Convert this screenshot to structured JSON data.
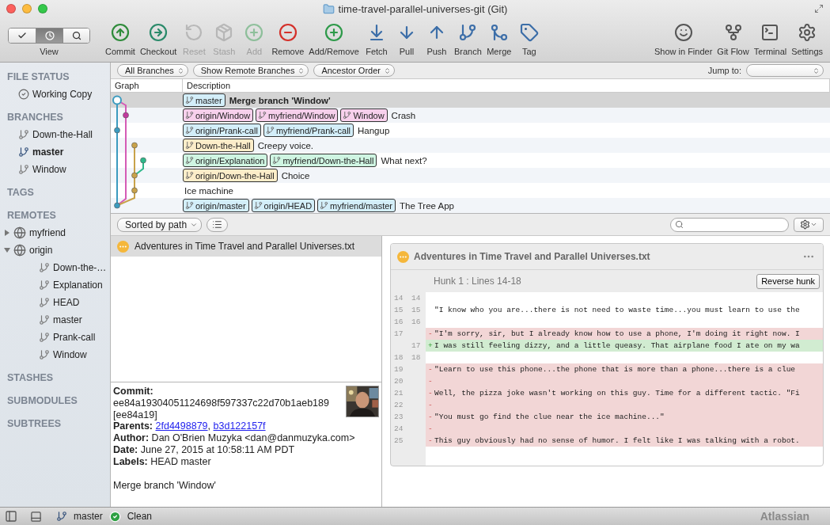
{
  "window": {
    "title": "time-travel-parallel-universes-git (Git)"
  },
  "toolbar": {
    "view": {
      "label": "View",
      "segments": [
        {
          "selected": false
        },
        {
          "selected": true
        },
        {
          "selected": false
        }
      ]
    },
    "buttons": [
      {
        "label": "Commit",
        "disabled": false
      },
      {
        "label": "Checkout",
        "disabled": false
      },
      {
        "label": "Reset",
        "disabled": true
      },
      {
        "label": "Stash",
        "disabled": true
      },
      {
        "label": "Add",
        "disabled": true
      },
      {
        "label": "Remove",
        "disabled": false
      },
      {
        "label": "Add/Remove",
        "disabled": false
      },
      {
        "label": "Fetch",
        "disabled": false
      },
      {
        "label": "Pull",
        "disabled": false
      },
      {
        "label": "Push",
        "disabled": false
      },
      {
        "label": "Branch",
        "disabled": false
      },
      {
        "label": "Merge",
        "disabled": false
      },
      {
        "label": "Tag",
        "disabled": false
      }
    ],
    "right_buttons": [
      {
        "label": "Show in Finder"
      },
      {
        "label": "Git Flow"
      },
      {
        "label": "Terminal"
      },
      {
        "label": "Settings"
      }
    ]
  },
  "sidebar": {
    "sections": [
      {
        "title": "FILE STATUS",
        "items": [
          {
            "label": "Working Copy",
            "kind": "status"
          }
        ]
      },
      {
        "title": "BRANCHES",
        "items": [
          {
            "label": "Down-the-Hall",
            "kind": "branch",
            "current": false
          },
          {
            "label": "master",
            "kind": "branch",
            "current": true
          },
          {
            "label": "Window",
            "kind": "branch",
            "current": false
          }
        ]
      },
      {
        "title": "TAGS"
      },
      {
        "title": "REMOTES",
        "items": [
          {
            "label": "myfriend",
            "kind": "remote",
            "expanded": false
          },
          {
            "label": "origin",
            "kind": "remote",
            "expanded": true,
            "children": [
              {
                "label": "Down-the-…",
                "kind": "branch"
              },
              {
                "label": "Explanation",
                "kind": "branch"
              },
              {
                "label": "HEAD",
                "kind": "branch"
              },
              {
                "label": "master",
                "kind": "branch"
              },
              {
                "label": "Prank-call",
                "kind": "branch"
              },
              {
                "label": "Window",
                "kind": "branch"
              }
            ]
          }
        ]
      },
      {
        "title": "STASHES"
      },
      {
        "title": "SUBMODULES"
      },
      {
        "title": "SUBTREES"
      }
    ]
  },
  "filters": {
    "dropdowns": [
      "All Branches",
      "Show Remote Branches",
      "Ancestor Order"
    ],
    "jump_label": "Jump to:"
  },
  "commit_table": {
    "columns": [
      "Graph",
      "Description"
    ],
    "rows": [
      {
        "selected": true,
        "current": true,
        "refs": [
          {
            "name": "master",
            "color": "#d3eef9"
          }
        ],
        "message": "Merge branch 'Window'"
      },
      {
        "selected": false,
        "current": false,
        "refs": [
          {
            "name": "origin/Window",
            "color": "#f7d0ec"
          },
          {
            "name": "myfriend/Window",
            "color": "#f7d0ec"
          },
          {
            "name": "Window",
            "color": "#f7d0ec"
          }
        ],
        "message": "Crash"
      },
      {
        "selected": false,
        "current": false,
        "refs": [
          {
            "name": "origin/Prank-call",
            "color": "#d3eef9"
          },
          {
            "name": "myfriend/Prank-call",
            "color": "#d3eef9"
          }
        ],
        "message": "Hangup"
      },
      {
        "selected": false,
        "current": false,
        "refs": [
          {
            "name": "Down-the-Hall",
            "color": "#fcedc9"
          }
        ],
        "message": "Creepy voice."
      },
      {
        "selected": false,
        "current": false,
        "refs": [
          {
            "name": "origin/Explanation",
            "color": "#cff5e2"
          },
          {
            "name": "myfriend/Down-the-Hall",
            "color": "#cff5e2"
          }
        ],
        "message": "What next?"
      },
      {
        "selected": false,
        "current": false,
        "refs": [
          {
            "name": "origin/Down-the-Hall",
            "color": "#fcedc9"
          }
        ],
        "message": "Choice"
      },
      {
        "selected": false,
        "current": false,
        "message": "Ice machine"
      },
      {
        "selected": false,
        "current": false,
        "refs": [
          {
            "name": "origin/master",
            "color": "#d3eef9"
          },
          {
            "name": "origin/HEAD",
            "color": "#d3eef9"
          },
          {
            "name": "myfriend/master",
            "color": "#d3eef9"
          }
        ],
        "message": "The Tree App"
      }
    ]
  },
  "file_toolbar": {
    "sort": "Sorted by path"
  },
  "files": [
    {
      "name": "Adventures in Time Travel and Parallel Universes.txt",
      "selected": true
    }
  ],
  "details": {
    "commit_label": "Commit:",
    "hash": "ee84a19304051124698f597337c22d70b1aeb189",
    "short_hash": "[ee84a19]",
    "parents": {
      "label": "Parents:",
      "links": [
        "2fd4498879",
        "b3d122157f"
      ],
      "separator": ","
    },
    "fields": [
      "**Author:** Dan O'Brien Muzyka <dan@danmuzyka.com>",
      "**Date:** June 27, 2015 at 10:58:11 AM PDT",
      "**Labels:** HEAD master"
    ],
    "message": "Merge branch 'Window'"
  },
  "diff": {
    "file": "Adventures in Time Travel and Parallel Universes.txt",
    "hunk": "Hunk 1 : Lines 14-18",
    "hunk_button": "Reverse hunk",
    "lines": [
      {
        "kind": "context",
        "old": "14",
        "new": "14"
      },
      {
        "kind": "context",
        "old": "15",
        "new": "15",
        "text": "\"I know who you are...there is not need to waste time...you must learn to use the"
      },
      {
        "kind": "context",
        "old": "16",
        "new": "16"
      },
      {
        "kind": "removed",
        "old": "17",
        "marker": "-",
        "text": "\"I'm sorry, sir, but I already know how to use a phone, I'm doing it right now. I"
      },
      {
        "kind": "added",
        "new": "17",
        "marker": "+",
        "text": "I was still feeling dizzy, and a little queasy. That airplane food I ate on my wa"
      },
      {
        "kind": "context",
        "old": "18",
        "new": "18"
      },
      {
        "kind": "removed",
        "old": "19",
        "marker": "-",
        "text": "\"Learn to use this phone...the phone that is more than a phone...there is a clue"
      },
      {
        "kind": "removed",
        "old": "20",
        "marker": "-"
      },
      {
        "kind": "removed",
        "old": "21",
        "marker": "-",
        "text": "Well, the pizza joke wasn't working on this guy. Time for a different tactic. \"Fi"
      },
      {
        "kind": "removed",
        "old": "22",
        "marker": "-"
      },
      {
        "kind": "removed",
        "old": "23",
        "marker": "-",
        "text": "\"You must go find the clue near the ice machine...\""
      },
      {
        "kind": "removed",
        "old": "24",
        "marker": "-"
      },
      {
        "kind": "removed",
        "old": "25",
        "marker": "-",
        "text": "This guy obviously had no sense of humor. I felt like I was talking with a robot."
      }
    ]
  },
  "status_bar": {
    "branch": "master",
    "state": "Clean",
    "brand": "Atlassian"
  }
}
